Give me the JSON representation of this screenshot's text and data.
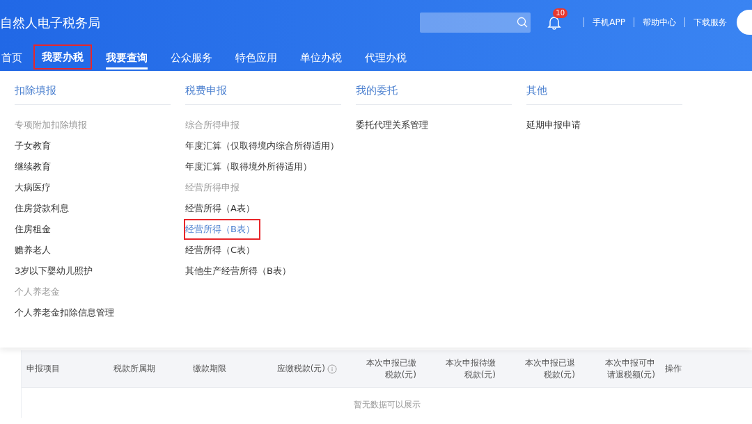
{
  "header": {
    "title": "自然人电子税务局",
    "notifications": {
      "count": "10"
    },
    "links": [
      "手机APP",
      "帮助中心",
      "下载服务"
    ]
  },
  "nav": [
    {
      "label": "首页",
      "selected": false,
      "highlighted": false
    },
    {
      "label": "我要办税",
      "selected": false,
      "highlighted": true
    },
    {
      "label": "我要查询",
      "selected": true,
      "highlighted": false
    },
    {
      "label": "公众服务",
      "selected": false,
      "highlighted": false
    },
    {
      "label": "特色应用",
      "selected": false,
      "highlighted": false
    },
    {
      "label": "单位办税",
      "selected": false,
      "highlighted": false
    },
    {
      "label": "代理办税",
      "selected": false,
      "highlighted": false
    }
  ],
  "menu": [
    {
      "heading": "扣除填报",
      "entries": [
        {
          "kind": "group",
          "label": "专项附加扣除填报"
        },
        {
          "kind": "item",
          "label": "子女教育",
          "highlighted": false
        },
        {
          "kind": "item",
          "label": "继续教育",
          "highlighted": false
        },
        {
          "kind": "item",
          "label": "大病医疗",
          "highlighted": false
        },
        {
          "kind": "item",
          "label": "住房贷款利息",
          "highlighted": false
        },
        {
          "kind": "item",
          "label": "住房租金",
          "highlighted": false
        },
        {
          "kind": "item",
          "label": "赡养老人",
          "highlighted": false
        },
        {
          "kind": "item",
          "label": "3岁以下婴幼儿照护",
          "highlighted": false
        },
        {
          "kind": "group",
          "label": "个人养老金"
        },
        {
          "kind": "item",
          "label": "个人养老金扣除信息管理",
          "highlighted": false
        }
      ]
    },
    {
      "heading": "税费申报",
      "entries": [
        {
          "kind": "group",
          "label": "综合所得申报"
        },
        {
          "kind": "item",
          "label": "年度汇算（仅取得境内综合所得适用）",
          "highlighted": false
        },
        {
          "kind": "item",
          "label": "年度汇算（取得境外所得适用）",
          "highlighted": false
        },
        {
          "kind": "group",
          "label": "经营所得申报"
        },
        {
          "kind": "item",
          "label": "经营所得（A表）",
          "highlighted": false
        },
        {
          "kind": "item",
          "label": "经营所得（B表）",
          "highlighted": true
        },
        {
          "kind": "item",
          "label": "经营所得（C表）",
          "highlighted": false
        },
        {
          "kind": "item",
          "label": "其他生产经营所得（B表）",
          "highlighted": false
        }
      ]
    },
    {
      "heading": "我的委托",
      "entries": [
        {
          "kind": "item",
          "label": "委托代理关系管理",
          "highlighted": false
        }
      ]
    },
    {
      "heading": "其他",
      "entries": [
        {
          "kind": "item",
          "label": "延期申报申请",
          "highlighted": false
        }
      ]
    }
  ],
  "table": {
    "columns": [
      {
        "label": "申报项目",
        "kind": "text",
        "info": false
      },
      {
        "label": "税款所属期",
        "kind": "text",
        "info": false
      },
      {
        "label": "缴款期限",
        "kind": "text",
        "info": false
      },
      {
        "label": "应缴税款(元)",
        "kind": "amount",
        "info": true
      },
      {
        "label": "本次申报已缴税款(元)",
        "kind": "amount",
        "info": false
      },
      {
        "label": "本次申报待缴税款(元)",
        "kind": "amount",
        "info": false
      },
      {
        "label": "本次申报已退税款(元)",
        "kind": "amount",
        "info": false
      },
      {
        "label": "本次申报可申请退税额(元)",
        "kind": "amount",
        "info": false
      },
      {
        "label": "操作",
        "kind": "text",
        "info": false
      }
    ],
    "empty_text": "暂无数据可以展示"
  }
}
